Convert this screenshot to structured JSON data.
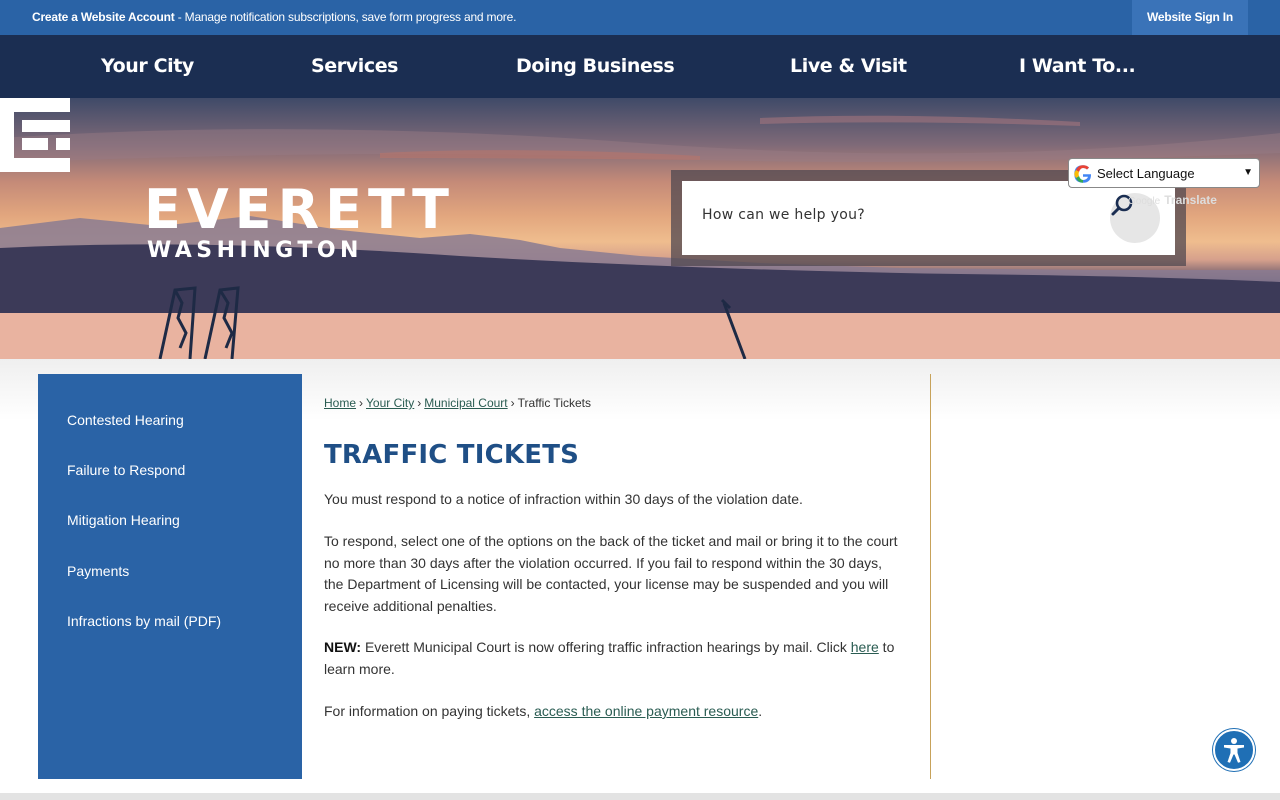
{
  "topbar": {
    "account_link": "Create a Website Account",
    "account_desc": " - Manage notification subscriptions, save form progress and more.",
    "sign_in": "Website Sign In"
  },
  "nav": {
    "items": [
      "Your City",
      "Services",
      "Doing Business",
      "Live & Visit",
      "I Want To..."
    ]
  },
  "hero": {
    "logo_title": "EVERETT",
    "logo_subtitle": "WASHINGTON"
  },
  "search": {
    "placeholder": "How can we help you?"
  },
  "translate": {
    "select_label": "Select Language",
    "powered_prefix": "Google",
    "powered_label": "Translate"
  },
  "sidebar": {
    "items": [
      {
        "label": "Contested Hearing"
      },
      {
        "label": "Failure to Respond"
      },
      {
        "label": "Mitigation Hearing"
      },
      {
        "label": "Payments"
      },
      {
        "label": "Infractions by mail (PDF)"
      }
    ]
  },
  "breadcrumb": {
    "links": [
      "Home",
      "Your City",
      "Municipal Court"
    ],
    "current": "Traffic Tickets",
    "separator": "›"
  },
  "page": {
    "title": "TRAFFIC TICKETS",
    "p1": "You must respond to a notice of infraction within 30 days of the violation date.",
    "p2": "To respond, select one of the options on the back of the ticket and mail or bring it to the court no more than 30 days after the violation occurred. If you fail to respond within the 30 days, the Department of Licensing will be contacted, your license may be suspended and you will receive additional penalties.",
    "p3_bold": "NEW:",
    "p3_text": " Everett Municipal Court is now offering traffic infraction hearings by mail. Click ",
    "p3_link": "here",
    "p3_tail": " to learn more.",
    "p4_text": "For information on paying tickets, ",
    "p4_link": "access the online payment resource",
    "p4_tail": "."
  },
  "colors": {
    "topbar": "#2a63a6",
    "nav": "#1b2e52",
    "sidebar": "#2a63a6",
    "title": "#1f4f86",
    "link": "#2a5c52",
    "rule": "#c7a25a"
  }
}
